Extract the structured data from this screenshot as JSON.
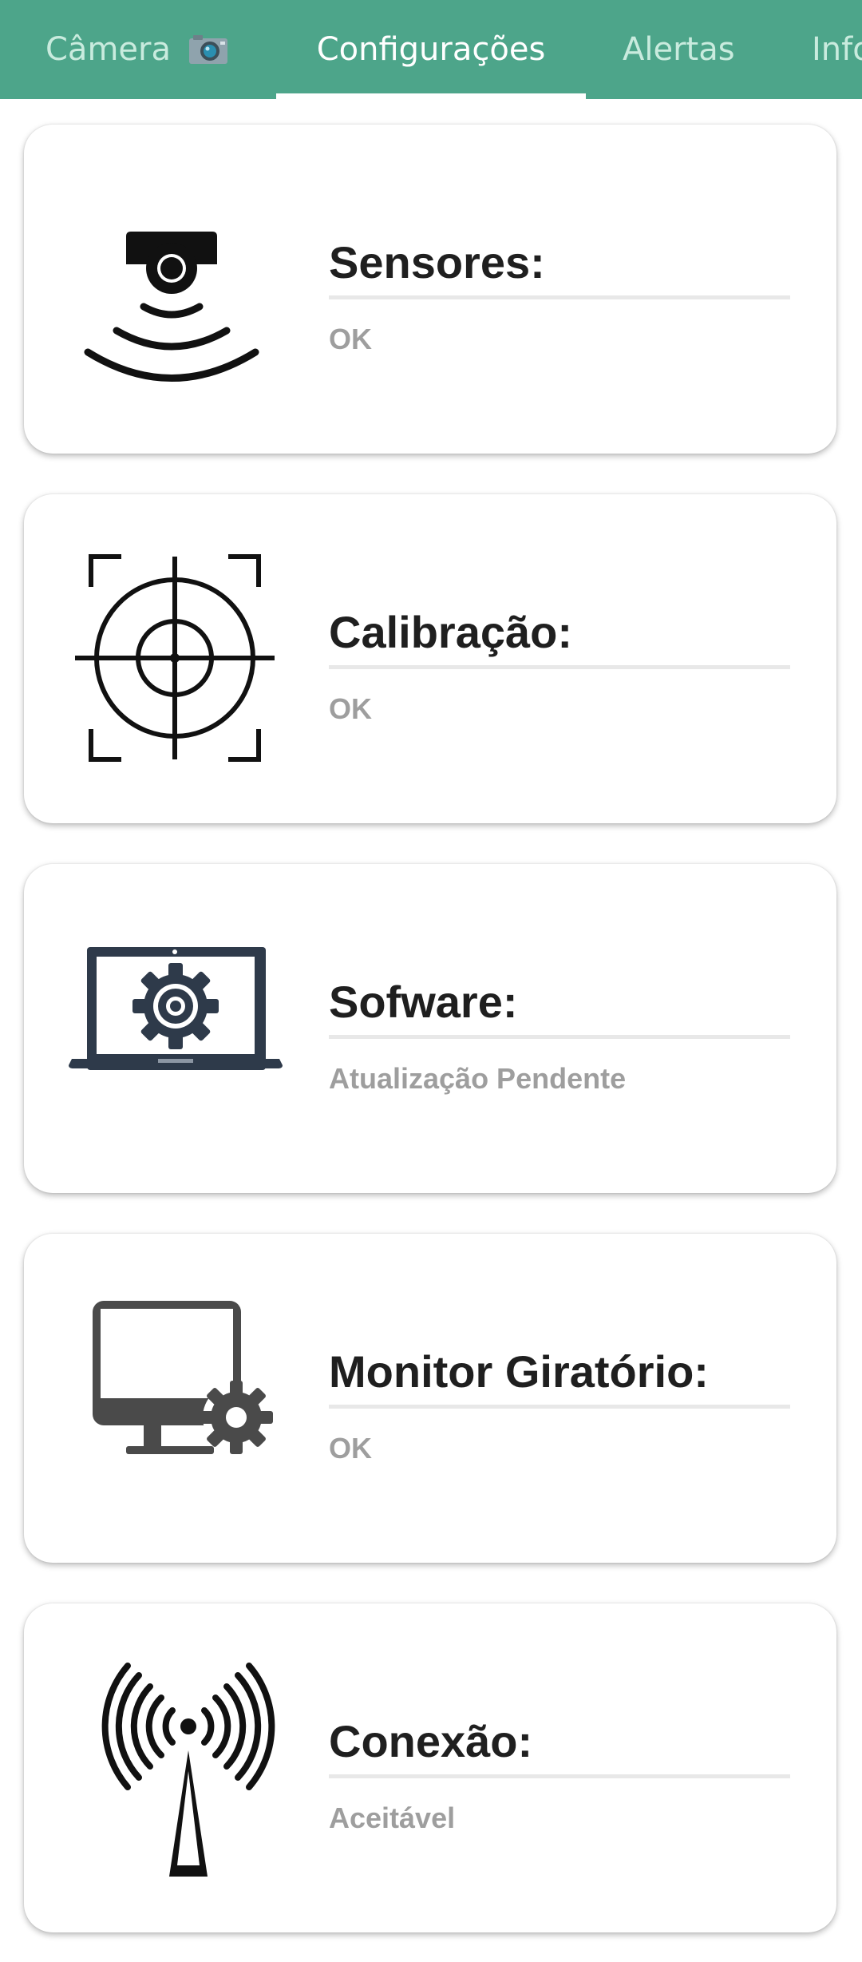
{
  "tabs": [
    {
      "label": "Câmera",
      "active": false
    },
    {
      "label": "Configurações",
      "active": true
    },
    {
      "label": "Alertas",
      "active": false
    },
    {
      "label": "Info",
      "active": false
    }
  ],
  "colors": {
    "accent": "#4da58a",
    "tab_text_inactive": "#c9ebde",
    "tab_text_active": "#ffffff",
    "title_text": "#1f1f1f",
    "status_text": "#9e9e9e",
    "icon_dark": "#2e3a4a"
  },
  "cards": [
    {
      "icon": "sensor-icon",
      "title": "Sensores:",
      "status": "OK"
    },
    {
      "icon": "calibration-target-icon",
      "title": "Calibração:",
      "status": "OK"
    },
    {
      "icon": "laptop-gear-icon",
      "title": "Sofware:",
      "status": "Atualização Pendente"
    },
    {
      "icon": "monitor-gear-icon",
      "title": "Monitor Giratório:",
      "status": "OK"
    },
    {
      "icon": "antenna-signal-icon",
      "title": "Conexão:",
      "status": "Aceitável"
    }
  ]
}
